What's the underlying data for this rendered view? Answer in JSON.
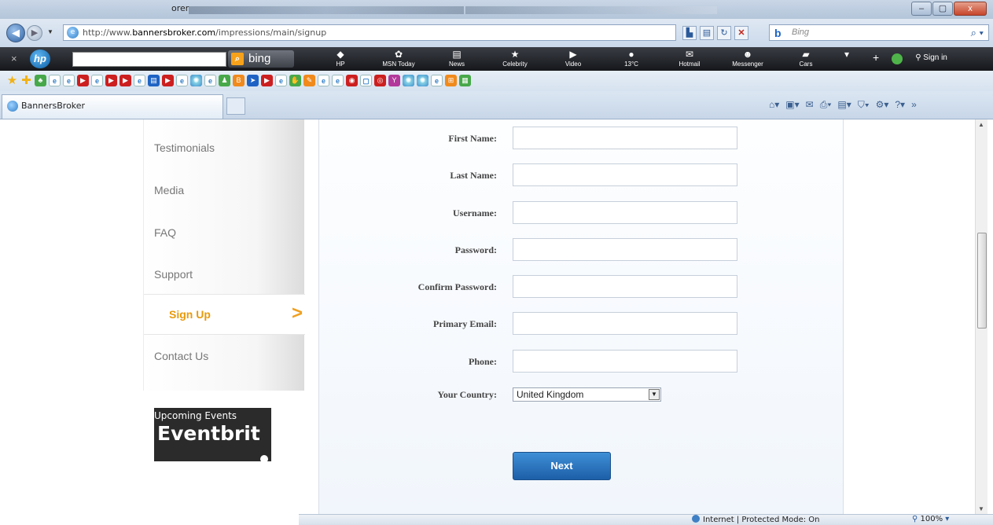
{
  "window": {
    "title": "orer",
    "buttons": [
      "–",
      "▢",
      "x"
    ]
  },
  "addressbar": {
    "url_prefix": "http://www.",
    "url_domain": "bannersbroker.com",
    "url_path": "/impressions/main/signup",
    "search_placeholder": "Bing"
  },
  "hp_toolbar": {
    "bing_label": "bing",
    "items": [
      {
        "label": "HP",
        "icon": "hp-icon"
      },
      {
        "label": "MSN Today",
        "icon": "msn-icon"
      },
      {
        "label": "News",
        "icon": "news-icon"
      },
      {
        "label": "Celebrity",
        "icon": "star-icon"
      },
      {
        "label": "Video",
        "icon": "video-icon"
      },
      {
        "label": "13°C",
        "icon": "weather-icon"
      },
      {
        "label": "Hotmail",
        "icon": "mail-icon"
      },
      {
        "label": "Messenger",
        "icon": "messenger-icon"
      },
      {
        "label": "Cars",
        "icon": "car-icon"
      }
    ],
    "sign_in": "Sign in"
  },
  "tab": {
    "title": "BannersBroker"
  },
  "sidebar": {
    "items": [
      {
        "label": "Testimonials"
      },
      {
        "label": "Media"
      },
      {
        "label": "FAQ"
      },
      {
        "label": "Support"
      },
      {
        "label": "Sign Up",
        "active": true
      },
      {
        "label": "Contact Us"
      }
    ]
  },
  "events": {
    "title": "Upcoming Events",
    "brand": "Eventbrit"
  },
  "form": {
    "fields": [
      {
        "label": "First Name:"
      },
      {
        "label": "Last Name:"
      },
      {
        "label": "Username:"
      },
      {
        "label": "Password:"
      },
      {
        "label": "Confirm Password:"
      },
      {
        "label": "Primary Email:"
      },
      {
        "label": "Phone:"
      }
    ],
    "country_label": "Your Country:",
    "country_value": "United Kingdom",
    "next_label": "Next"
  },
  "statusbar": {
    "zone": "Internet | Protected Mode: On",
    "zoom": "100%"
  },
  "colors": {
    "accent_orange": "#e89a0c",
    "button_blue": "#1c5fa8"
  }
}
